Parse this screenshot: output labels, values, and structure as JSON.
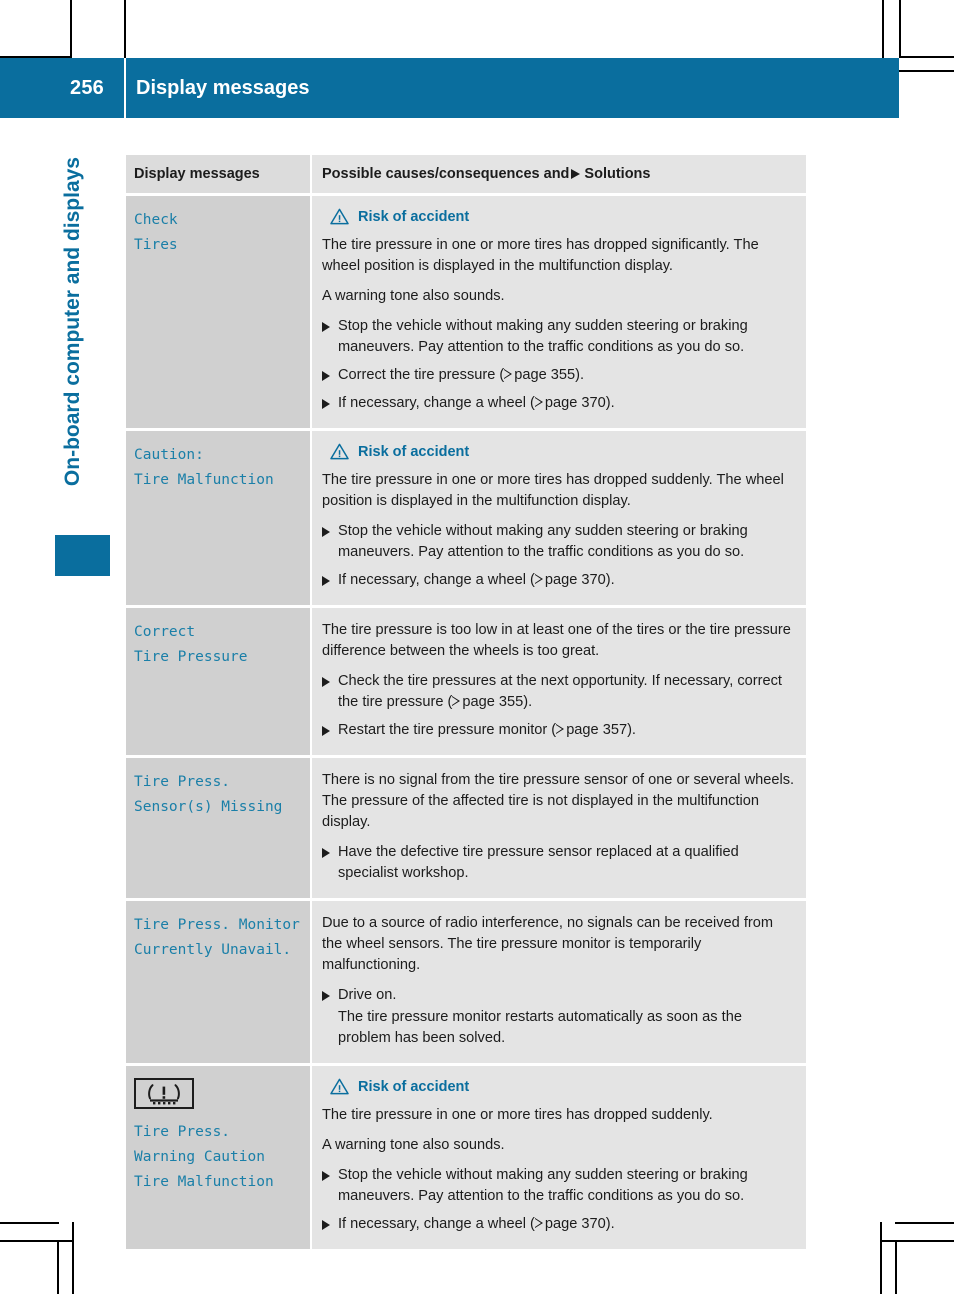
{
  "header": {
    "page_number": "256",
    "title": "Display messages",
    "accent_color": "#0a6e9e"
  },
  "sidebar": {
    "chapter_label": "On-board computer and displays",
    "tab_color": "#0a6e9e"
  },
  "table": {
    "columns": {
      "left": "Display messages",
      "right_prefix": "Possible causes/consequences and",
      "right_suffix": "Solutions"
    },
    "rows": [
      {
        "message_lines": [
          "Check",
          "Tires"
        ],
        "has_icon": false,
        "warning": "Risk of accident",
        "paragraphs": [
          "The tire pressure in one or more tires has dropped significantly. The wheel position is displayed in the multifunction display.",
          "A warning tone also sounds."
        ],
        "steps": [
          {
            "text": "Stop the vehicle without making any sudden steering or braking maneuvers. Pay attention to the traffic conditions as you do so."
          },
          {
            "text_before": "Correct the tire pressure (",
            "page_ref": "page 355",
            "text_after": ")."
          },
          {
            "text_before": "If necessary, change a wheel (",
            "page_ref": "page 370",
            "text_after": ")."
          }
        ]
      },
      {
        "message_lines": [
          "Caution:",
          "Tire Malfunction"
        ],
        "has_icon": false,
        "warning": "Risk of accident",
        "paragraphs": [
          "The tire pressure in one or more tires has dropped suddenly. The wheel position is displayed in the multifunction display."
        ],
        "steps": [
          {
            "text": "Stop the vehicle without making any sudden steering or braking maneuvers. Pay attention to the traffic conditions as you do so."
          },
          {
            "text_before": "If necessary, change a wheel (",
            "page_ref": "page 370",
            "text_after": ")."
          }
        ]
      },
      {
        "message_lines": [
          "Correct",
          "Tire Pressure"
        ],
        "has_icon": false,
        "warning": null,
        "paragraphs": [
          "The tire pressure is too low in at least one of the tires or the tire pressure difference between the wheels is too great."
        ],
        "steps": [
          {
            "text_before": "Check the tire pressures at the next opportunity. If necessary, correct the tire pressure (",
            "page_ref": "page 355",
            "text_after": ")."
          },
          {
            "text_before": "Restart the tire pressure monitor (",
            "page_ref": "page 357",
            "text_after": ")."
          }
        ]
      },
      {
        "message_lines": [
          "Tire Press.",
          "Sensor(s) Missing"
        ],
        "has_icon": false,
        "warning": null,
        "paragraphs": [
          "There is no signal from the tire pressure sensor of one or several wheels. The pressure of the affected tire is not displayed in the multifunction display."
        ],
        "steps": [
          {
            "text": "Have the defective tire pressure sensor replaced at a qualified specialist workshop."
          }
        ]
      },
      {
        "message_lines": [
          "Tire Press. Monitor",
          "Currently Unavail."
        ],
        "has_icon": false,
        "warning": null,
        "paragraphs": [
          "Due to a source of radio interference, no signals can be received from the wheel sensors. The tire pressure monitor is temporarily malfunctioning."
        ],
        "steps": [
          {
            "text": "Drive on.",
            "sub_text": "The tire pressure monitor restarts automatically as soon as the problem has been solved."
          }
        ]
      },
      {
        "message_lines": [
          "Tire Press.",
          "Warning Caution",
          "Tire Malfunction"
        ],
        "has_icon": true,
        "icon_name": "tire-pressure-warning-icon",
        "warning": "Risk of accident",
        "paragraphs": [
          "The tire pressure in one or more tires has dropped suddenly.",
          "A warning tone also sounds."
        ],
        "steps": [
          {
            "text": "Stop the vehicle without making any sudden steering or braking maneuvers. Pay attention to the traffic conditions as you do so."
          },
          {
            "text_before": "If necessary, change a wheel (",
            "page_ref": "page 370",
            "text_after": ")."
          }
        ]
      }
    ]
  }
}
